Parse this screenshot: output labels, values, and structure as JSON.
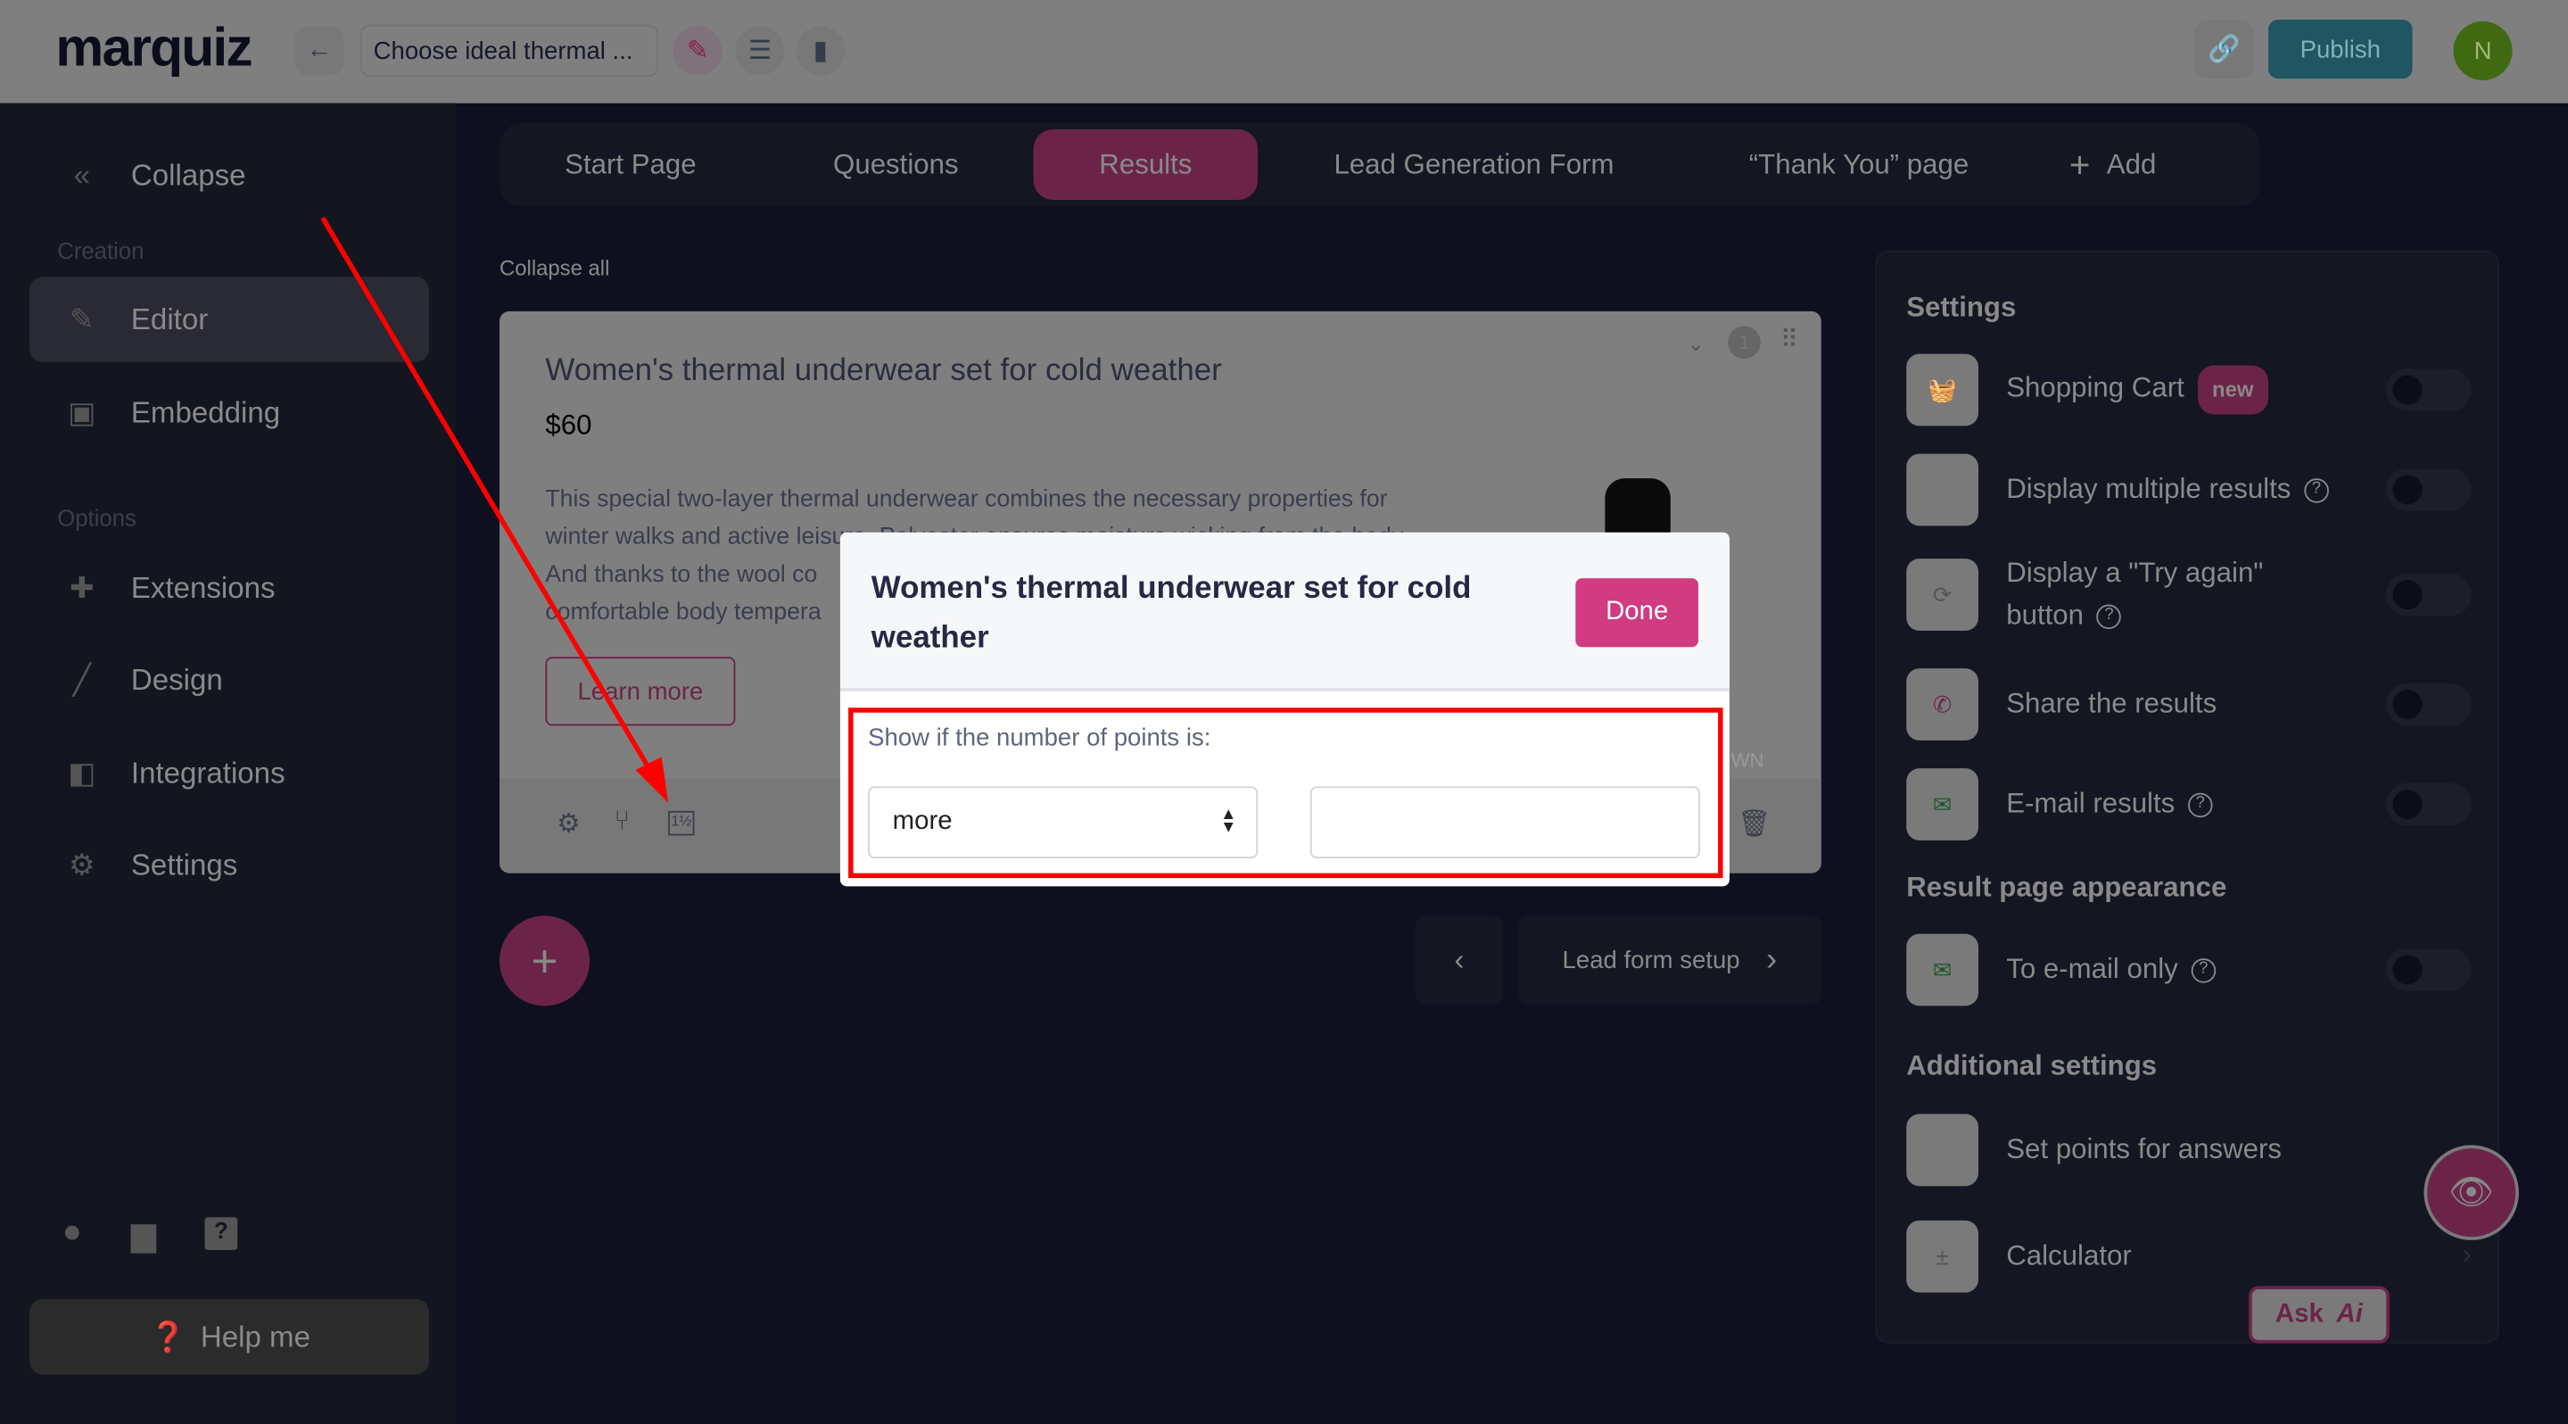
{
  "header": {
    "logo": "marquiz",
    "quiz_title": "Choose ideal thermal ...",
    "publish_label": "Publish",
    "avatar_initial": "N"
  },
  "sidebar": {
    "collapse": "Collapse",
    "section_creation": "Creation",
    "section_options": "Options",
    "items": [
      {
        "label": "Editor",
        "icon": "pencil-icon"
      },
      {
        "label": "Embedding",
        "icon": "embed-icon"
      },
      {
        "label": "Extensions",
        "icon": "puzzle-icon"
      },
      {
        "label": "Design",
        "icon": "brush-icon"
      },
      {
        "label": "Integrations",
        "icon": "plug-icon"
      },
      {
        "label": "Settings",
        "icon": "gear-icon"
      }
    ],
    "help": "Help me"
  },
  "tabs": [
    {
      "label": "Start Page"
    },
    {
      "label": "Questions"
    },
    {
      "label": "Results",
      "active": true
    },
    {
      "label": "Lead Generation Form"
    },
    {
      "label": "“Thank You” page"
    },
    {
      "label": "Add"
    }
  ],
  "main": {
    "collapse_all": "Collapse all",
    "result": {
      "title": "Women's thermal underwear set for cold weather",
      "price": "$60",
      "number": "1",
      "description": [
        "This special two-layer thermal underwear combines the necessary properties for",
        "winter walks and active leisure. Polyester ensures moisture wicking from the body.",
        "And thanks to the wool co",
        "comfortable body tempera"
      ],
      "button": "Learn more",
      "watermark": "WN"
    },
    "next_label": "Lead form setup"
  },
  "modal": {
    "title": "Women's thermal underwear set for cold weather",
    "done": "Done",
    "label": "Show if the number of points is:",
    "select_value": "more",
    "points_value": ""
  },
  "right_panel": {
    "settings_title": "Settings",
    "settings": [
      {
        "label": "Shopping Cart",
        "badge": "new",
        "enabled": false
      },
      {
        "label": "Display multiple results",
        "help": true,
        "enabled": false
      },
      {
        "label": "Display a \"Try again\" button",
        "help": true,
        "enabled": false
      },
      {
        "label": "Share the results",
        "enabled": false
      },
      {
        "label": "E-mail results",
        "help": true,
        "enabled": false
      }
    ],
    "appearance_title": "Result page appearance",
    "appearance": [
      {
        "label": "To e-mail only",
        "help": true,
        "enabled": false
      }
    ],
    "additional_title": "Additional settings",
    "additional": [
      {
        "label": "Set points for answers"
      },
      {
        "label": "Calculator"
      }
    ],
    "ask_label": "Ask"
  },
  "colors": {
    "accent": "#d13b80",
    "annotation": "#ff0000",
    "publish": "#1f5662"
  }
}
